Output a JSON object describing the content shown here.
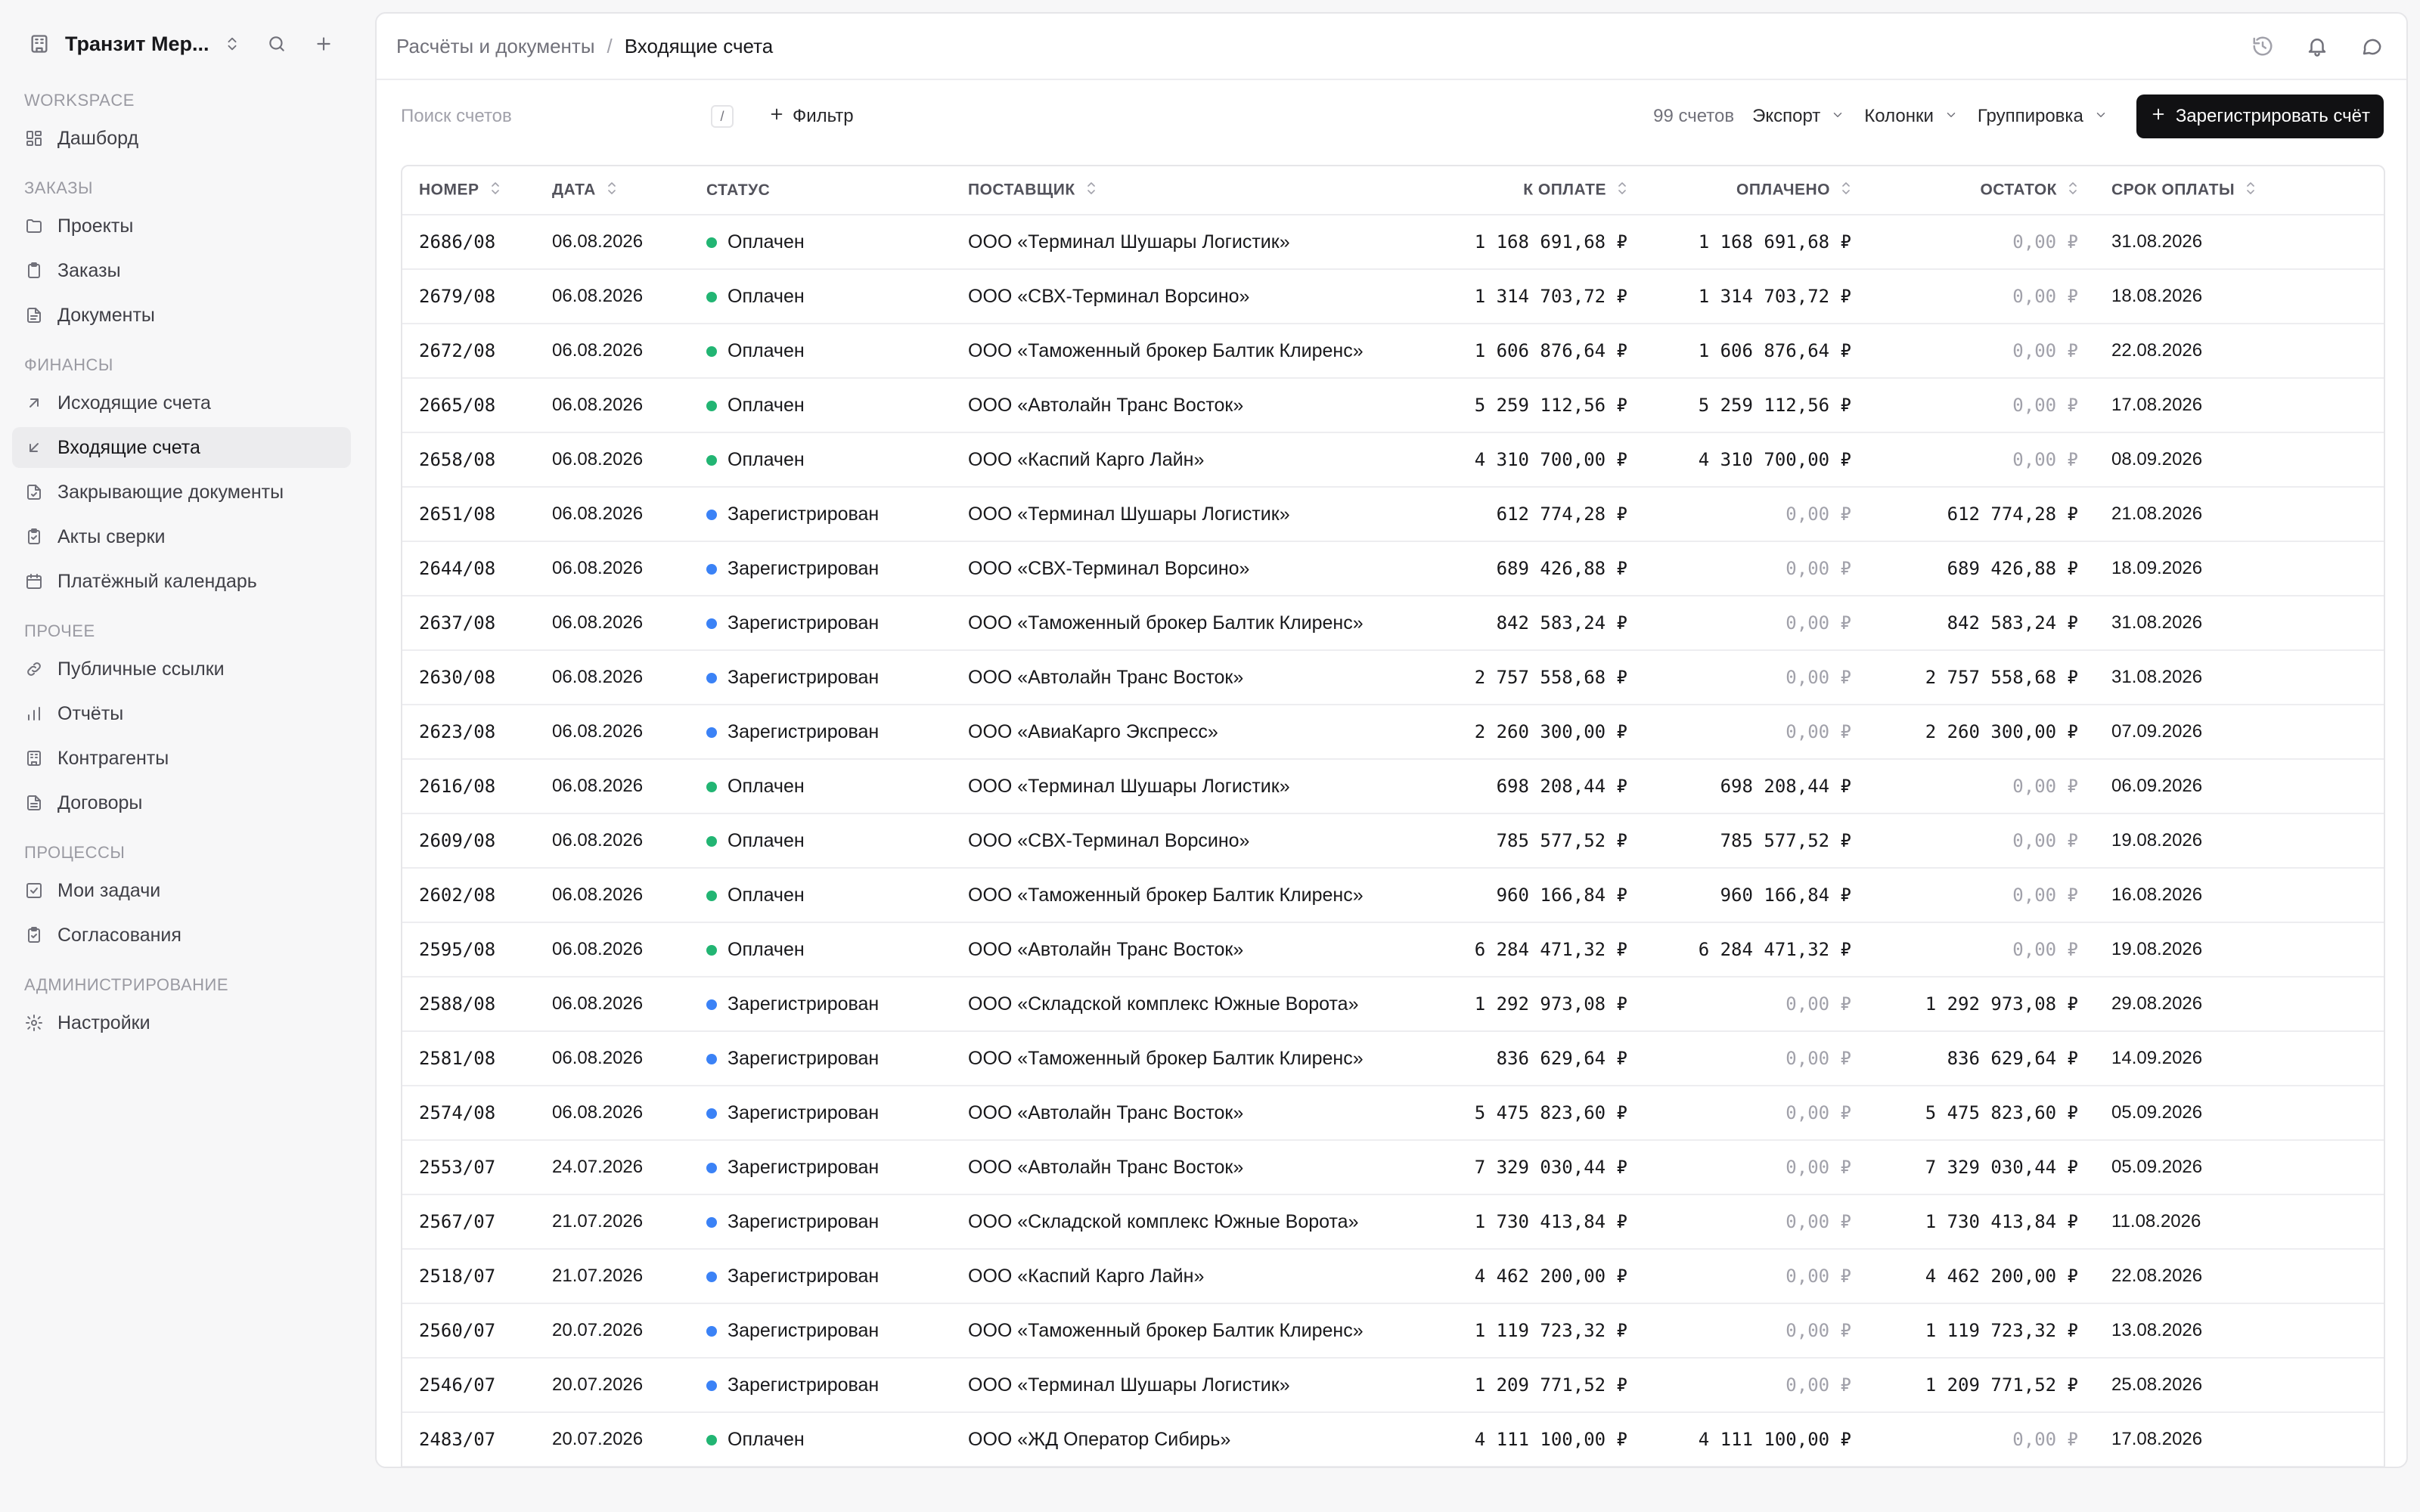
{
  "workspace": {
    "name": "Транзит Мер..."
  },
  "nav": {
    "sections": [
      {
        "title": "WORKSPACE",
        "items": [
          {
            "label": "Дашборд",
            "icon": "dashboard-icon"
          }
        ]
      },
      {
        "title": "ЗАКАЗЫ",
        "items": [
          {
            "label": "Проекты",
            "icon": "folder-icon"
          },
          {
            "label": "Заказы",
            "icon": "clipboard-icon"
          },
          {
            "label": "Документы",
            "icon": "file-icon"
          }
        ]
      },
      {
        "title": "ФИНАНСЫ",
        "items": [
          {
            "label": "Исходящие счета",
            "icon": "arrow-up-right-icon"
          },
          {
            "label": "Входящие счета",
            "icon": "arrow-down-left-icon",
            "active": true
          },
          {
            "label": "Закрывающие документы",
            "icon": "file-check-icon"
          },
          {
            "label": "Акты сверки",
            "icon": "clipboard-check-icon"
          },
          {
            "label": "Платёжный календарь",
            "icon": "calendar-icon"
          }
        ]
      },
      {
        "title": "ПРОЧЕЕ",
        "items": [
          {
            "label": "Публичные ссылки",
            "icon": "link-icon"
          },
          {
            "label": "Отчёты",
            "icon": "bar-chart-icon"
          },
          {
            "label": "Контрагенты",
            "icon": "building-icon"
          },
          {
            "label": "Договоры",
            "icon": "document-icon"
          }
        ]
      },
      {
        "title": "ПРОЦЕССЫ",
        "items": [
          {
            "label": "Мои задачи",
            "icon": "check-square-icon"
          },
          {
            "label": "Согласования",
            "icon": "clipboard-check-icon"
          }
        ]
      },
      {
        "title": "АДМИНИСТРИРОВАНИЕ",
        "items": [
          {
            "label": "Настройки",
            "icon": "gear-icon"
          }
        ]
      }
    ]
  },
  "breadcrumb": {
    "parent": "Расчёты и документы",
    "separator": "/",
    "current": "Входящие счета"
  },
  "toolbar": {
    "search_placeholder": "Поиск счетов",
    "search_shortcut": "/",
    "filter_label": "Фильтр",
    "count_label": "99 счетов",
    "export_label": "Экспорт",
    "columns_label": "Колонки",
    "grouping_label": "Группировка",
    "primary_label": "Зарегистрировать счёт"
  },
  "table": {
    "columns": [
      "НОМЕР",
      "ДАТА",
      "СТАТУС",
      "ПОСТАВЩИК",
      "К ОПЛАТЕ",
      "ОПЛАЧЕНО",
      "ОСТАТОК",
      "СРОК ОПЛАТЫ"
    ],
    "status_colors": {
      "Оплачен": "#22b573",
      "Зарегистрирован": "#3b82f6"
    },
    "rows": [
      [
        "2686/08",
        "06.08.2026",
        "Оплачен",
        "ООО «Терминал Шушары Логистик»",
        "1 168 691,68 ₽",
        "1 168 691,68 ₽",
        "0,00 ₽",
        "31.08.2026"
      ],
      [
        "2679/08",
        "06.08.2026",
        "Оплачен",
        "ООО «СВХ-Терминал Ворсино»",
        "1 314 703,72 ₽",
        "1 314 703,72 ₽",
        "0,00 ₽",
        "18.08.2026"
      ],
      [
        "2672/08",
        "06.08.2026",
        "Оплачен",
        "ООО «Таможенный брокер Балтик Клиренс»",
        "1 606 876,64 ₽",
        "1 606 876,64 ₽",
        "0,00 ₽",
        "22.08.2026"
      ],
      [
        "2665/08",
        "06.08.2026",
        "Оплачен",
        "ООО «Автолайн Транс Восток»",
        "5 259 112,56 ₽",
        "5 259 112,56 ₽",
        "0,00 ₽",
        "17.08.2026"
      ],
      [
        "2658/08",
        "06.08.2026",
        "Оплачен",
        "ООО «Каспий Карго Лайн»",
        "4 310 700,00 ₽",
        "4 310 700,00 ₽",
        "0,00 ₽",
        "08.09.2026"
      ],
      [
        "2651/08",
        "06.08.2026",
        "Зарегистрирован",
        "ООО «Терминал Шушары Логистик»",
        "612 774,28 ₽",
        "0,00 ₽",
        "612 774,28 ₽",
        "21.08.2026"
      ],
      [
        "2644/08",
        "06.08.2026",
        "Зарегистрирован",
        "ООО «СВХ-Терминал Ворсино»",
        "689 426,88 ₽",
        "0,00 ₽",
        "689 426,88 ₽",
        "18.09.2026"
      ],
      [
        "2637/08",
        "06.08.2026",
        "Зарегистрирован",
        "ООО «Таможенный брокер Балтик Клиренс»",
        "842 583,24 ₽",
        "0,00 ₽",
        "842 583,24 ₽",
        "31.08.2026"
      ],
      [
        "2630/08",
        "06.08.2026",
        "Зарегистрирован",
        "ООО «Автолайн Транс Восток»",
        "2 757 558,68 ₽",
        "0,00 ₽",
        "2 757 558,68 ₽",
        "31.08.2026"
      ],
      [
        "2623/08",
        "06.08.2026",
        "Зарегистрирован",
        "ООО «АвиаКарго Экспресс»",
        "2 260 300,00 ₽",
        "0,00 ₽",
        "2 260 300,00 ₽",
        "07.09.2026"
      ],
      [
        "2616/08",
        "06.08.2026",
        "Оплачен",
        "ООО «Терминал Шушары Логистик»",
        "698 208,44 ₽",
        "698 208,44 ₽",
        "0,00 ₽",
        "06.09.2026"
      ],
      [
        "2609/08",
        "06.08.2026",
        "Оплачен",
        "ООО «СВХ-Терминал Ворсино»",
        "785 577,52 ₽",
        "785 577,52 ₽",
        "0,00 ₽",
        "19.08.2026"
      ],
      [
        "2602/08",
        "06.08.2026",
        "Оплачен",
        "ООО «Таможенный брокер Балтик Клиренс»",
        "960 166,84 ₽",
        "960 166,84 ₽",
        "0,00 ₽",
        "16.08.2026"
      ],
      [
        "2595/08",
        "06.08.2026",
        "Оплачен",
        "ООО «Автолайн Транс Восток»",
        "6 284 471,32 ₽",
        "6 284 471,32 ₽",
        "0,00 ₽",
        "19.08.2026"
      ],
      [
        "2588/08",
        "06.08.2026",
        "Зарегистрирован",
        "ООО «Складской комплекс Южные Ворота»",
        "1 292 973,08 ₽",
        "0,00 ₽",
        "1 292 973,08 ₽",
        "29.08.2026"
      ],
      [
        "2581/08",
        "06.08.2026",
        "Зарегистрирован",
        "ООО «Таможенный брокер Балтик Клиренс»",
        "836 629,64 ₽",
        "0,00 ₽",
        "836 629,64 ₽",
        "14.09.2026"
      ],
      [
        "2574/08",
        "06.08.2026",
        "Зарегистрирован",
        "ООО «Автолайн Транс Восток»",
        "5 475 823,60 ₽",
        "0,00 ₽",
        "5 475 823,60 ₽",
        "05.09.2026"
      ],
      [
        "2553/07",
        "24.07.2026",
        "Зарегистрирован",
        "ООО «Автолайн Транс Восток»",
        "7 329 030,44 ₽",
        "0,00 ₽",
        "7 329 030,44 ₽",
        "05.09.2026"
      ],
      [
        "2567/07",
        "21.07.2026",
        "Зарегистрирован",
        "ООО «Складской комплекс Южные Ворота»",
        "1 730 413,84 ₽",
        "0,00 ₽",
        "1 730 413,84 ₽",
        "11.08.2026"
      ],
      [
        "2518/07",
        "21.07.2026",
        "Зарегистрирован",
        "ООО «Каспий Карго Лайн»",
        "4 462 200,00 ₽",
        "0,00 ₽",
        "4 462 200,00 ₽",
        "22.08.2026"
      ],
      [
        "2560/07",
        "20.07.2026",
        "Зарегистрирован",
        "ООО «Таможенный брокер Балтик Клиренс»",
        "1 119 723,32 ₽",
        "0,00 ₽",
        "1 119 723,32 ₽",
        "13.08.2026"
      ],
      [
        "2546/07",
        "20.07.2026",
        "Зарегистрирован",
        "ООО «Терминал Шушары Логистик»",
        "1 209 771,52 ₽",
        "0,00 ₽",
        "1 209 771,52 ₽",
        "25.08.2026"
      ],
      [
        "2483/07",
        "20.07.2026",
        "Оплачен",
        "ООО «ЖД Оператор Сибирь»",
        "4 111 100,00 ₽",
        "4 111 100,00 ₽",
        "0,00 ₽",
        "17.08.2026"
      ]
    ]
  }
}
